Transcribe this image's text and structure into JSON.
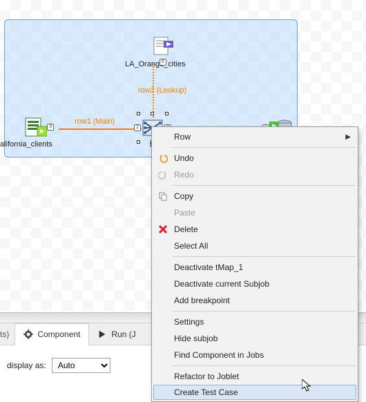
{
  "nodes": {
    "input1": {
      "label": "California_clients"
    },
    "input2": {
      "label": "LA_Orange_cities"
    },
    "map": {
      "label": "tMa"
    },
    "output": {
      "label": ""
    }
  },
  "edges": {
    "row1": "row1 (Main)",
    "row2": "row2 (Lookup)"
  },
  "panel": {
    "tab_trunc": "ts)",
    "tab_component": "Component",
    "tab_run_trunc": "Run (J",
    "prop_label": "display as:",
    "prop_value": "Auto"
  },
  "menu": {
    "row": "Row",
    "undo": "Undo",
    "redo": "Redo",
    "copy": "Copy",
    "paste": "Paste",
    "delete": "Delete",
    "select_all": "Select All",
    "deactivate_tmap": "Deactivate tMap_1",
    "deactivate_subjob": "Deactivate current Subjob",
    "add_breakpoint": "Add breakpoint",
    "settings": "Settings",
    "hide_subjob": "Hide subjob",
    "find_component": "Find Component in Jobs",
    "refactor_joblet": "Refactor to Joblet",
    "create_test_case": "Create Test Case"
  }
}
